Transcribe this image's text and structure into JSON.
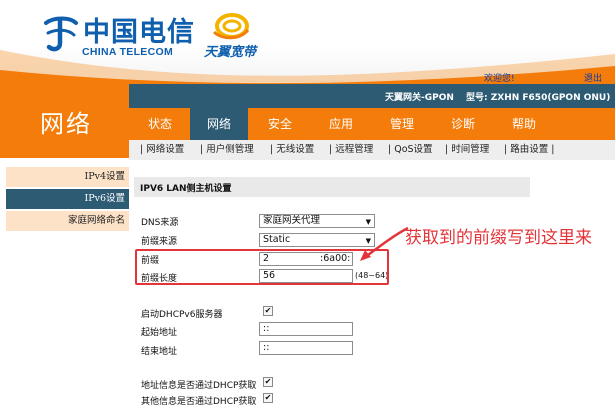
{
  "brand": {
    "telecom_cn": "中国电信",
    "telecom_en": "CHINA TELECOM",
    "tianyi": "天翼宽带"
  },
  "header": {
    "welcome": "欢迎您!",
    "logout": "退出",
    "gateway_label": "天翼网关-GPON",
    "model_label": "型号: ZXHN F650(GPON ONU)"
  },
  "left": {
    "title": "网络",
    "items": [
      "IPv4设置",
      "IPv6设置",
      "家庭网络命名"
    ]
  },
  "tabs": [
    "状态",
    "网络",
    "安全",
    "应用",
    "管理",
    "诊断",
    "帮助"
  ],
  "subtabs": [
    "网络设置",
    "用户侧管理",
    "无线设置",
    "远程管理",
    "QoS设置",
    "时间管理",
    "路由设置"
  ],
  "content": {
    "section_title": "IPV6 LAN侧主机设置",
    "dns_source_label": "DNS来源",
    "dns_source_value": "家庭网关代理",
    "prefix_source_label": "前缀来源",
    "prefix_source_value": "Static",
    "prefix_label": "前缀",
    "prefix_value_start": "2",
    "prefix_value_end": ":6a00:",
    "prefix_len_label": "前缀长度",
    "prefix_len_value": "56",
    "prefix_len_hint": "(48~64)",
    "dhcpv6_label": "启动DHCPv6服务器",
    "start_addr_label": "起始地址",
    "start_addr_value": "::",
    "end_addr_label": "结束地址",
    "end_addr_value": "::",
    "addr_dhcp_label": "地址信息是否通过DHCP获取",
    "other_dhcp_label": "其他信息是否通过DHCP获取"
  },
  "annotation": "获取到的前缀写到这里来",
  "colors": {
    "orange": "#f37c0a",
    "teal": "#2d5b74",
    "brand_blue": "#0f5fae",
    "annotation_red": "#e3343a"
  }
}
